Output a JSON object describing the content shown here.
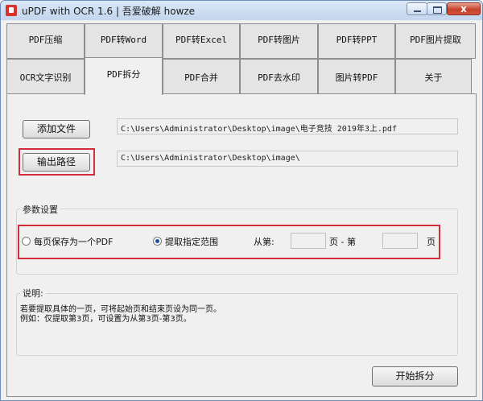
{
  "window": {
    "title": "uPDF with OCR 1.6 | 吾爱破解 howze",
    "close_symbol": "x"
  },
  "tabs_row1": [
    "PDF压缩",
    "PDF转Word",
    "PDF转Excel",
    "PDF转图片",
    "PDF转PPT",
    "PDF图片提取"
  ],
  "tabs_row2": [
    "OCR文字识别",
    "PDF拆分",
    "PDF合并",
    "PDF去水印",
    "图片转PDF",
    "关于"
  ],
  "active_tab": "PDF拆分",
  "add_file": {
    "label": "添加文件",
    "path": "C:\\Users\\Administrator\\Desktop\\image\\电子竞技 2019年3上.pdf"
  },
  "output_path": {
    "label": "输出路径",
    "path": "C:\\Users\\Administrator\\Desktop\\image\\"
  },
  "params": {
    "group_label": "参数设置",
    "option_each_page": "每页保存为一个PDF",
    "option_range": "提取指定范围",
    "selected": "option_range",
    "from_label": "从第:",
    "page_to_label": "页 - 第",
    "page_label": "页",
    "from_value": "",
    "to_value": ""
  },
  "notes": {
    "group_label": "说明:",
    "line1": "若要提取具体的一页，可将起始页和结束页设为同一页。",
    "line2": "例如：仅提取第3页，可设置为从第3页-第3页。"
  },
  "start_button": "开始拆分",
  "colors": {
    "highlight_red": "#d42c3c",
    "title_bar": "#c3d6ee"
  },
  "icons": [
    "pdf-app-icon",
    "minimize-icon",
    "maximize-icon",
    "close-icon",
    "radio-icon"
  ]
}
